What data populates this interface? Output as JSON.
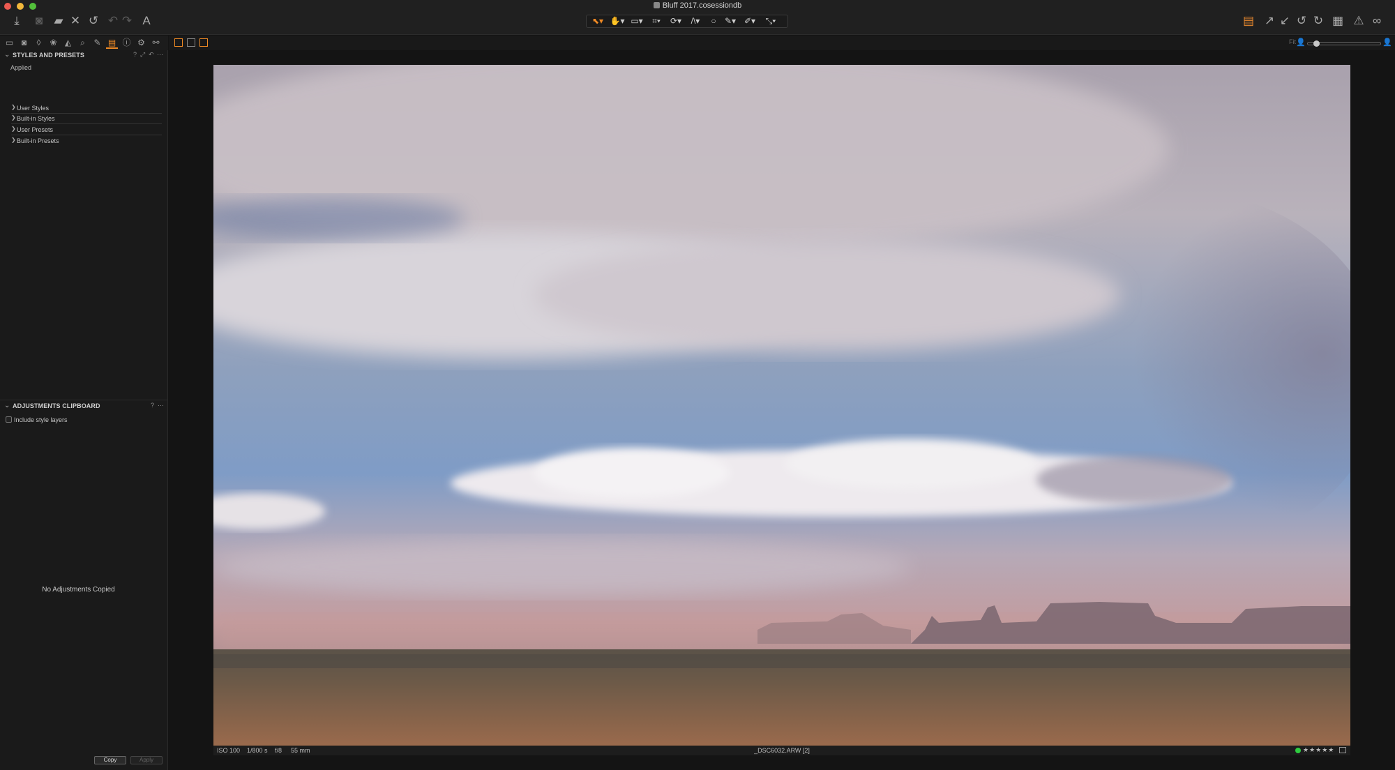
{
  "window": {
    "title": "Bluff 2017.cosessiondb"
  },
  "toolbar": {
    "left_icons": [
      "import-icon",
      "camera-icon",
      "folder-icon",
      "close-icon",
      "undo-history-icon",
      "undo-icon",
      "redo-icon",
      "text-icon"
    ],
    "cursor_tools": [
      "select-cursor-icon",
      "pan-icon",
      "loupe-icon",
      "crop-icon",
      "rotate-icon",
      "keystone-icon",
      "spot-icon",
      "brush-icon",
      "eraser-icon",
      "picker-icon"
    ],
    "right_icons": [
      "layers-icon",
      "export-icon",
      "process-icon",
      "rotate-left-icon",
      "rotate-right-icon",
      "grid-icon",
      "warning-icon",
      "proof-glasses-icon"
    ]
  },
  "viewer_controls": {
    "fit_label": "Fit"
  },
  "styles_panel": {
    "title": "STYLES AND PRESETS",
    "controls": [
      "?",
      "⤢",
      "↶",
      "⋯"
    ],
    "applied_label": "Applied",
    "items": [
      {
        "label": "User Styles"
      },
      {
        "label": "Built-in Styles"
      },
      {
        "label": "User Presets"
      },
      {
        "label": "Built-in Presets"
      }
    ]
  },
  "clipboard_panel": {
    "title": "ADJUSTMENTS CLIPBOARD",
    "controls": [
      "?",
      "⋯"
    ],
    "include_style_layers": "Include style layers",
    "empty_message": "No Adjustments Copied",
    "copy_label": "Copy",
    "apply_label": "Apply"
  },
  "image_info": {
    "iso": "ISO 100",
    "shutter": "1/800 s",
    "aperture": "f/8",
    "focal": "55 mm",
    "filename": "_DSC6032.ARW [2]",
    "stars": "★★★★★",
    "color_tag": "#2ecc40"
  },
  "colors": {
    "accent": "#f08a24",
    "panel_bg": "#1a1a1a",
    "viewer_bg": "#141414"
  }
}
